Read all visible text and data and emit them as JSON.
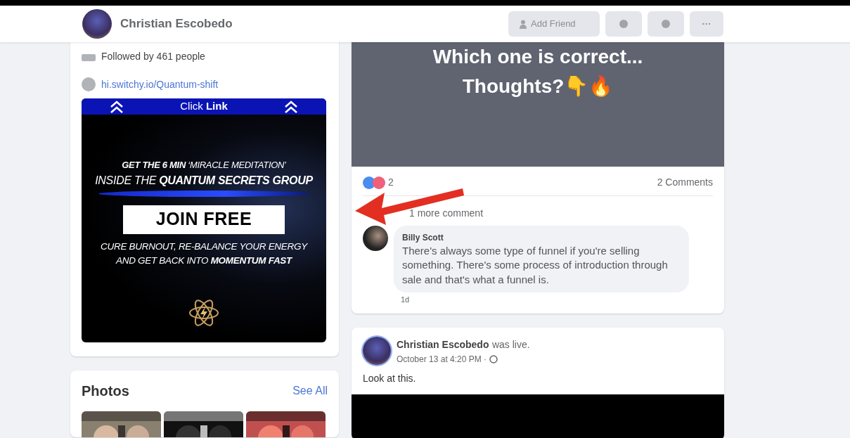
{
  "header": {
    "name": "Christian Escobedo",
    "add_friend_button": "Add Friend",
    "more_button": "···"
  },
  "intro": {
    "followed_by": "Followed by 461 people",
    "link": "hi.switchy.io/Quantum-shift"
  },
  "ad": {
    "banner": "Click **Link**",
    "line_1": "**GET THE 6 MIN**  ‘MIRACLE MEDITATION’",
    "line_2": "INSIDE THE **QUANTUM SECRETS GROUP**",
    "button": "JOIN FREE",
    "line_3": "CURE BURNOUT, RE-BALANCE YOUR ENERGY",
    "line_4": "AND GET BACK INTO **MOMENTUM FAST**"
  },
  "photos": {
    "title": "Photos",
    "see_all": "See All"
  },
  "post_1": {
    "image_text": "Which one is correct... Thoughts?👇🔥",
    "reaction_count": "2",
    "comment_count": "2 Comments",
    "more_comments": "1 more comment",
    "comments": [
      {
        "author": "Billy Scott",
        "text": "There's always some type of funnel if you're selling something. There's some process of introduction through sale and that's what a funnel is.",
        "time": "1d"
      }
    ]
  },
  "post_2": {
    "author": "Christian Escobedo",
    "action": "was live.",
    "date": "October 13 at 4:20 PM ·",
    "text": "Look at this."
  }
}
